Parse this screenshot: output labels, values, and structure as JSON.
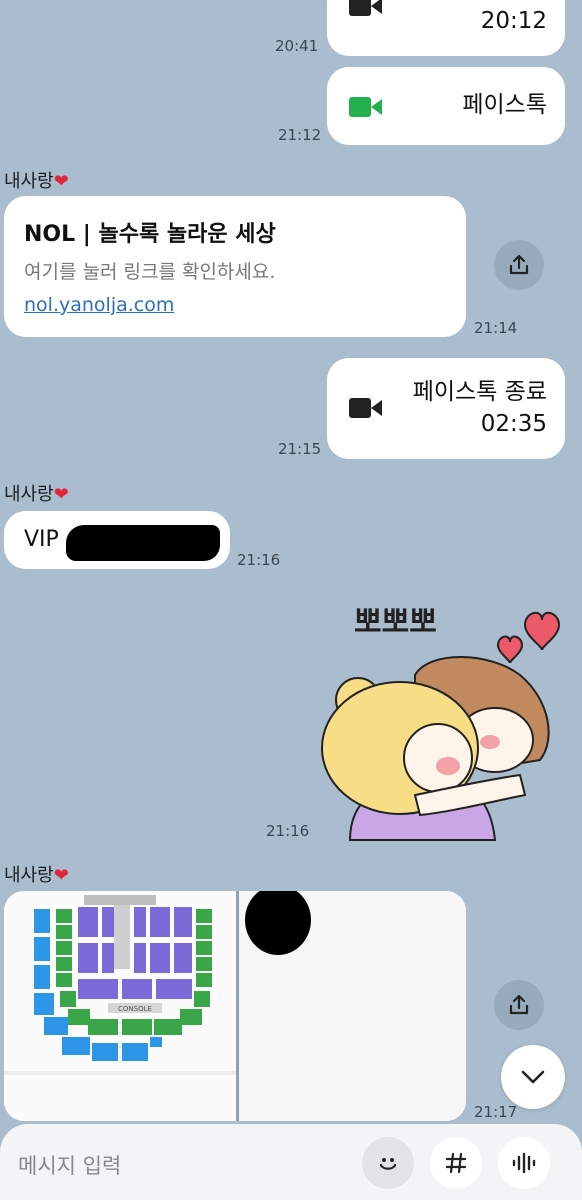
{
  "sender_name": "내사랑",
  "messages": {
    "call1": {
      "duration": "20:12",
      "time": "20:41"
    },
    "call2": {
      "label": "페이스톡",
      "time": "21:12"
    },
    "link": {
      "title": "NOL | 놀수록 놀라운 세상",
      "description": "여기를 눌러 링크를 확인하세요.",
      "url": "nol.yanolja.com",
      "time": "21:14"
    },
    "call3": {
      "label": "페이스톡 종료",
      "duration": "02:35",
      "time": "21:15"
    },
    "vip": {
      "text": "VIP",
      "time": "21:16"
    },
    "sticker": {
      "text": "뽀뽀뽀",
      "time": "21:16"
    },
    "seatmap": {
      "console_label": "CONSOLE",
      "time": "21:17"
    }
  },
  "input": {
    "placeholder": "메시지 입력"
  },
  "icons": {
    "video": "video-call-icon",
    "share": "share-icon",
    "emoji": "emoji-icon",
    "hashtag": "hashtag-icon",
    "voice": "voice-icon",
    "scroll_down": "chevron-down-icon"
  },
  "colors": {
    "background": "#a9bdce",
    "video_active": "#22b14c",
    "heart": "#e0243a",
    "link": "#2c6fc1"
  }
}
